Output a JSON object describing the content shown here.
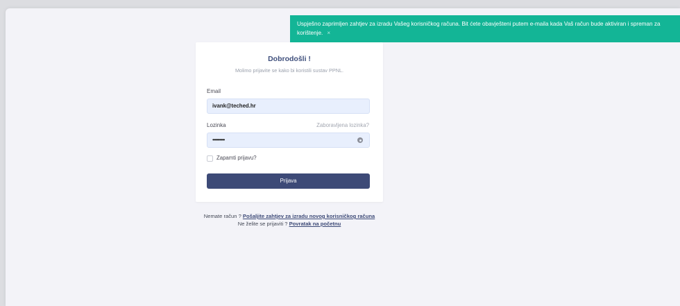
{
  "toast": {
    "message": "Uspješno zaprimljen zahtjev za izradu Vašeg korisničkog računa. Bit ćete obavješteni putem e-maila kada Vaš račun bude aktiviran i spreman za korištenje.",
    "close_icon": "×",
    "color": "#13b596"
  },
  "login": {
    "title": "Dobrodošli !",
    "subtitle": "Molimo prijavite se kako bi koristili sustav PPNL.",
    "email_label": "Email",
    "email_value": "ivank@teched.hr",
    "password_label": "Lozinka",
    "forgot_password": "Zaboravljena lozinka?",
    "password_value": "••••••••••",
    "remember_label": "Zapamti prijavu?",
    "submit_label": "Prijava",
    "button_color": "#3d4a77"
  },
  "footer": {
    "no_account_text": "Nemate račun ? ",
    "request_link": "Pošaljite zahtjev za izradu novog korisničkog računa",
    "no_login_text": "Ne želite se prijaviti ? ",
    "back_link": "Povratak na početnu"
  }
}
